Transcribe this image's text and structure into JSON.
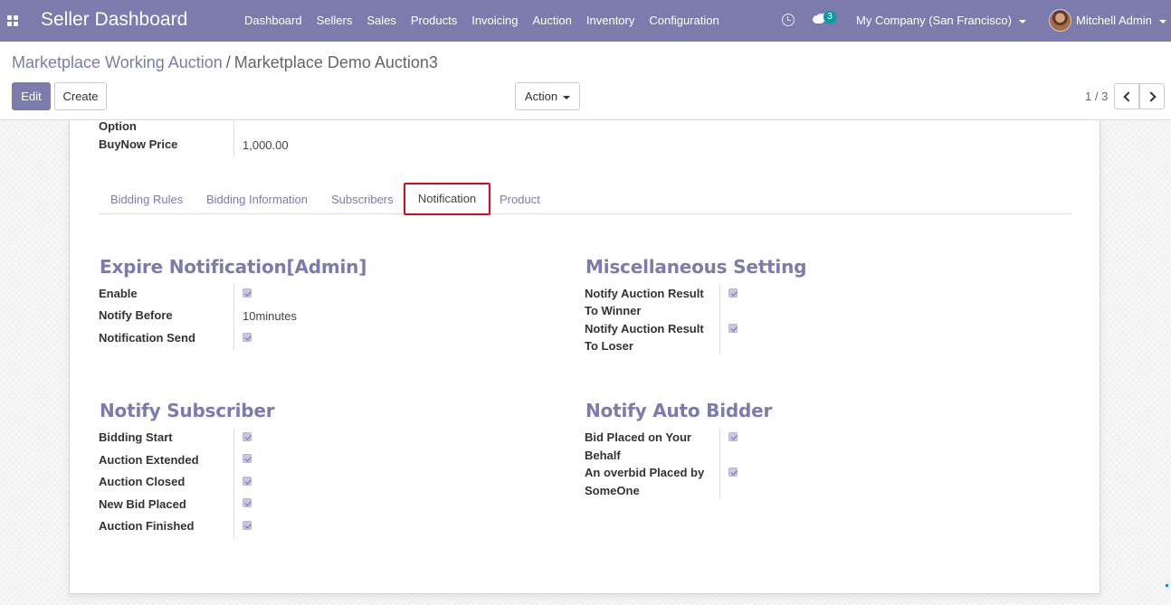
{
  "navbar": {
    "brand": "Seller Dashboard",
    "menu": [
      "Dashboard",
      "Sellers",
      "Sales",
      "Products",
      "Invoicing",
      "Auction",
      "Inventory",
      "Configuration"
    ],
    "messages_count": "3",
    "company": "My Company (San Francisco)",
    "user": "Mitchell Admin"
  },
  "breadcrumb": {
    "parent": "Marketplace Working Auction",
    "separator": "/",
    "current": "Marketplace Demo Auction3"
  },
  "toolbar": {
    "edit_label": "Edit",
    "create_label": "Create",
    "action_label": "Action",
    "pager": "1 / 3"
  },
  "form_top": {
    "option_label": "Option",
    "buynow_label": "BuyNow Price",
    "buynow_value": "1,000.00"
  },
  "tabs": [
    "Bidding Rules",
    "Bidding Information",
    "Subscribers",
    "Notification",
    "Product"
  ],
  "expire_notification": {
    "title": "Expire Notification[Admin]",
    "enable_label": "Enable",
    "enable": true,
    "notify_before_label": "Notify Before",
    "notify_before_value": "10minutes",
    "notification_send_label": "Notification Send",
    "notification_send": true
  },
  "misc_setting": {
    "title": "Miscellaneous Setting",
    "winner_label_1": "Notify Auction Result",
    "winner_label_2": "To Winner",
    "winner": true,
    "loser_label_1": "Notify Auction Result",
    "loser_label_2": "To Loser",
    "loser": true
  },
  "notify_subscriber": {
    "title": "Notify Subscriber",
    "items": [
      {
        "label": "Bidding Start",
        "checked": true
      },
      {
        "label": "Auction Extended",
        "checked": true
      },
      {
        "label": "Auction Closed",
        "checked": true
      },
      {
        "label": "New Bid Placed",
        "checked": true
      },
      {
        "label": "Auction Finished",
        "checked": true
      }
    ]
  },
  "notify_auto_bidder": {
    "title": "Notify Auto Bidder",
    "bid_placed_label_1": "Bid Placed on Your",
    "bid_placed_label_2": "Behalf",
    "bid_placed": true,
    "overbid_label_1": "An overbid Placed by",
    "overbid_label_2": "SomeOne",
    "overbid": true
  },
  "colors": {
    "navbar": "#7c7bad",
    "accent": "#7c7bad",
    "highlight_border": "#e3061b",
    "badge": "#00a09d"
  }
}
